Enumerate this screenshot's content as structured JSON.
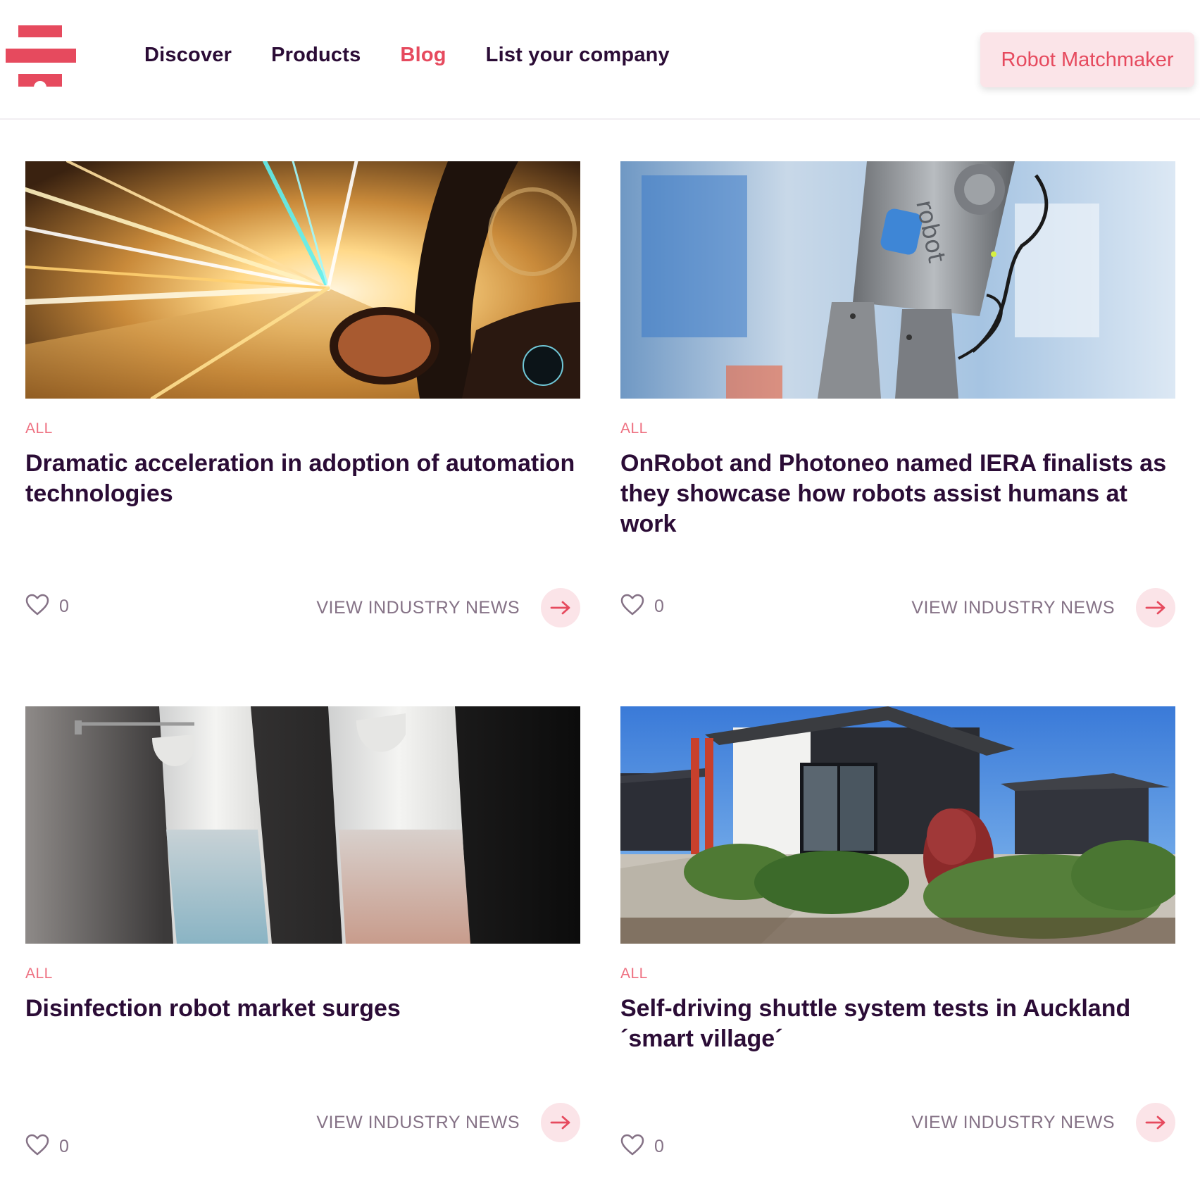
{
  "header": {
    "nav": [
      "Discover",
      "Products",
      "Blog",
      "List your company"
    ],
    "active_nav": "Blog",
    "cta_label": "Robot Matchmaker"
  },
  "colors": {
    "accent": "#e64a5e",
    "accent_light": "#fbe4e8",
    "text_dark": "#2b0c36",
    "text_muted": "#857286"
  },
  "cards": [
    {
      "category": "ALL",
      "title": "Dramatic acceleration in adoption of automation technologies",
      "likes": "0",
      "view_label": "VIEW INDUSTRY NEWS",
      "image": "car-light-streaks-photo"
    },
    {
      "category": "ALL",
      "title": "OnRobot and Photoneo named IERA finalists as they showcase how robots assist humans at work",
      "likes": "0",
      "view_label": "VIEW INDUSTRY NEWS",
      "image": "onrobot-gripper-photo",
      "image_text": "robot"
    },
    {
      "category": "ALL",
      "title": "Disinfection robot market surges",
      "likes": "0",
      "view_label": "VIEW INDUSTRY NEWS",
      "image": "sanitizer-dispensers-photo"
    },
    {
      "category": "ALL",
      "title": "Self-driving shuttle system tests in Auckland ´smart village´",
      "likes": "0",
      "view_label": "VIEW INDUSTRY NEWS",
      "image": "modern-house-garden-photo"
    }
  ]
}
